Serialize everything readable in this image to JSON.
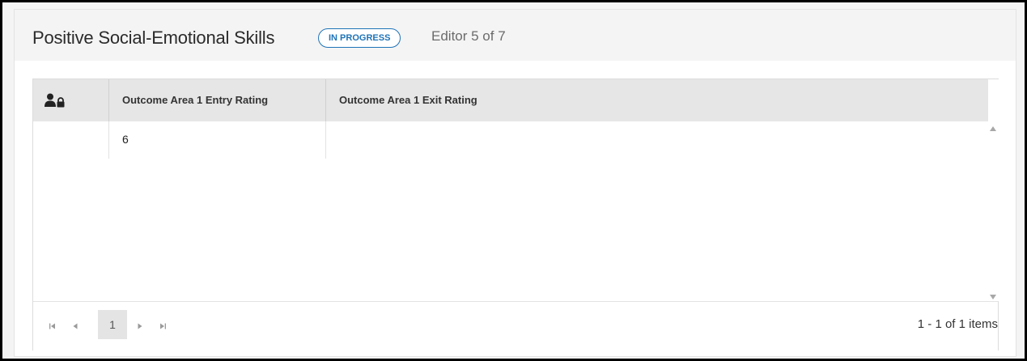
{
  "header": {
    "title": "Positive Social-Emotional Skills",
    "status_badge": "IN PROGRESS",
    "editor_count": "Editor 5 of 7"
  },
  "grid": {
    "columns": [
      {
        "icon": "person-lock-icon",
        "label": ""
      },
      {
        "label": "Outcome Area 1 Entry Rating"
      },
      {
        "label": "Outcome Area 1 Exit Rating"
      }
    ],
    "rows": [
      {
        "icon_cell": "",
        "entry_rating": "6",
        "exit_rating": ""
      }
    ]
  },
  "pager": {
    "current_page": "1",
    "summary": "1 - 1 of 1 items"
  },
  "colors": {
    "accent": "#1f73b7",
    "header_bg": "#e6e6e6",
    "frame": "#000000"
  }
}
